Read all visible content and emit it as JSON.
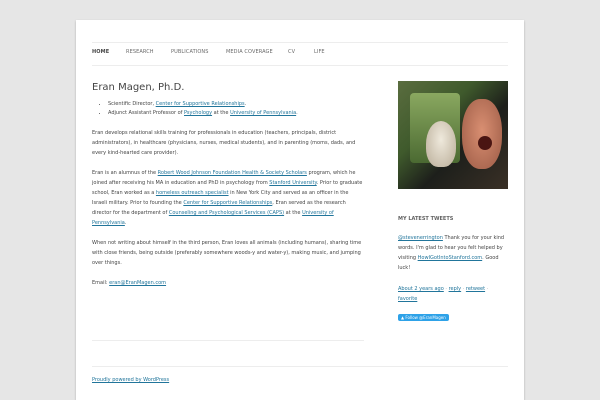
{
  "nav": {
    "items": [
      {
        "label": "HOME",
        "active": true
      },
      {
        "label": "RESEARCH",
        "active": false
      },
      {
        "label": "PUBLICATIONS",
        "active": false
      },
      {
        "label": "MEDIA COVERAGE",
        "active": false
      },
      {
        "label": "CV",
        "active": false
      },
      {
        "label": "LIFE",
        "active": false
      }
    ]
  },
  "main": {
    "title": "Eran Magen, Ph.D.",
    "bullets": [
      {
        "prefix": "Scientific Director, ",
        "link": "Center for Supportive Relationships",
        "suffix": "."
      },
      {
        "prefix": "Adjunct Assistant Professor of ",
        "link1": "Psychology",
        "mid": " at the ",
        "link2": "University of Pennsylvania",
        "suffix": "."
      }
    ],
    "para1": "Eran develops relational skills training for professionals in education (teachers, principals, district administrators), in healthcare (physicians, nurses, medical students), and in parenting (moms, dads, and every kind-hearted care provider).",
    "para2": {
      "t1": "Eran is an alumnus of the ",
      "l1": "Robert Wood Johnson Foundation Health & Society Scholars",
      "t2": " program, which he joined after receiving his MA in education and PhD in psychology from ",
      "l2": "Stanford University",
      "t3": ". Prior to graduate school, Eran worked as a ",
      "l3": "homeless outreach specialist",
      "t4": " in New York City and served as an officer in the Israeli military. Prior to founding the ",
      "l4": "Center for Supportive Relationships",
      "t5": ", Eran served as the research director for the department of ",
      "l5": "Counseling and Psychological Services (CAPS)",
      "t6": " at the ",
      "l6": "University of Pennsylvania",
      "t7": "."
    },
    "para3": "When not writing about himself in the third person, Eran loves all animals (including humans), sharing time with close friends, being outside (preferably somewhere woods-y and water-y), making music, and jumping over things.",
    "email_label": "Email: ",
    "email": "eran@EranMagen.com"
  },
  "sidebar": {
    "widget_title": "MY LATEST TWEETS",
    "tweet": {
      "handle": "@stevenerrington",
      "text1": " Thank you for your kind words. I'm glad to hear you felt helped by visiting ",
      "link": "HowIGotIntoStanford.com",
      "text2": ". Good luck!"
    },
    "meta": {
      "time": "About 2 years ago",
      "sep": " · ",
      "reply": "reply",
      "retweet": "retweet",
      "favorite": "favorite"
    },
    "follow_label": "Follow @EranMagen"
  },
  "footer": {
    "credit": "Proudly powered by WordPress"
  },
  "colors": {
    "link": "#21759b",
    "follow_button": "#2ea2e8",
    "background": "#e6e6e6"
  }
}
